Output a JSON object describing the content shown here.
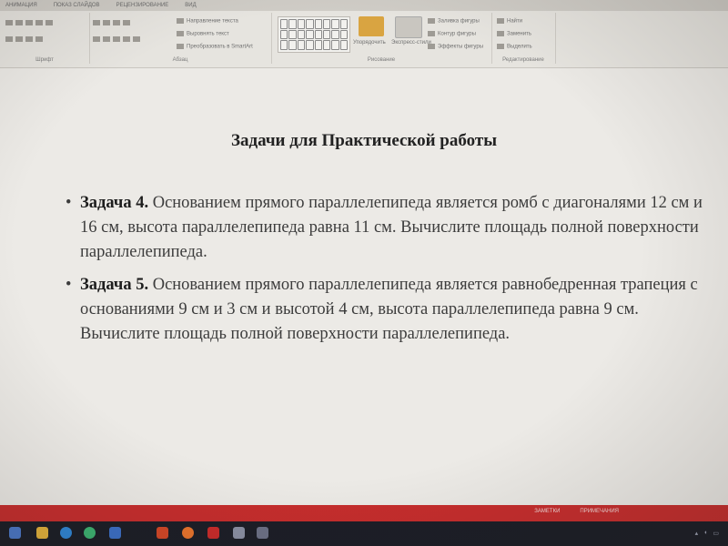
{
  "ribbon": {
    "tabs": [
      "АНИМАЦИЯ",
      "ПОКАЗ СЛАЙДОВ",
      "РЕЦЕНЗИРОВАНИЕ",
      "ВИД"
    ],
    "paragraph": {
      "text_direction": "Направление текста",
      "align_text": "Выровнять текст",
      "convert_smartart": "Преобразовать в SmartArt",
      "group_label": "Абзац"
    },
    "font_group_label": "Шрифт",
    "drawing": {
      "arrange": "Упорядочить",
      "quick_styles": "Экспресс-стили",
      "shape_fill": "Заливка фигуры",
      "shape_outline": "Контур фигуры",
      "shape_effects": "Эффекты фигуры",
      "group_label": "Рисование"
    },
    "editing": {
      "find": "Найти",
      "replace": "Заменить",
      "select": "Выделить",
      "group_label": "Редактирование"
    }
  },
  "slide": {
    "title": "Задачи для Практической работы",
    "bullet_symbol": "•",
    "tasks": [
      {
        "label": "Задача 4.",
        "text": "Основанием прямого параллелепипеда является ромб с диагоналями 12 см и 16 см, высота параллелепипеда равна 11 см. Вычислите площадь полной поверхности параллелепипеда."
      },
      {
        "label": "Задача 5.",
        "text": "Основанием прямого параллелепипеда является равнобедренная трапеция с основаниями 9 см и 3 см и высотой 4 см, высота параллелепипеда равна 9 см. Вычислите площадь полной поверхности параллелепипеда."
      }
    ]
  },
  "statusbar": {
    "notes": "ЗАМЕТКИ",
    "comments": "ПРИМЕЧАНИЯ"
  },
  "colors": {
    "statusbar": "#c62d2d",
    "taskbar": "#1b1d26",
    "slide_bg": "#eceae6"
  },
  "taskbar": {
    "icons": [
      "start-icon",
      "file-explorer-icon",
      "edge-icon",
      "whatsapp-icon",
      "word-icon",
      "powerpoint-icon",
      "firefox-icon",
      "acrobat-icon",
      "app-icon",
      "app-icon-2"
    ]
  }
}
